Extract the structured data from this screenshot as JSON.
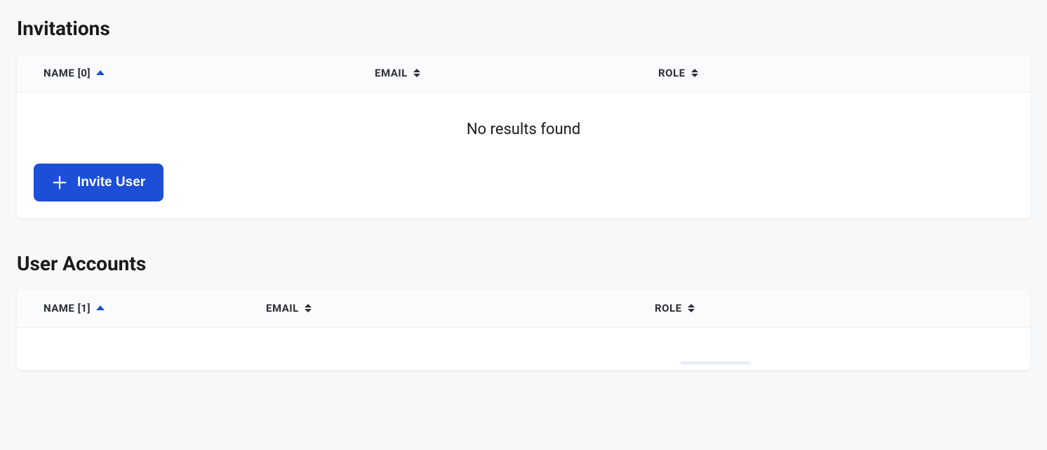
{
  "invitations": {
    "title": "Invitations",
    "columns": {
      "name": "NAME [0]",
      "email": "EMAIL",
      "role": "ROLE"
    },
    "empty_message": "No results found",
    "invite_button_label": "Invite User"
  },
  "user_accounts": {
    "title": "User Accounts",
    "columns": {
      "name": "NAME [1]",
      "email": "EMAIL",
      "role": "ROLE"
    }
  }
}
